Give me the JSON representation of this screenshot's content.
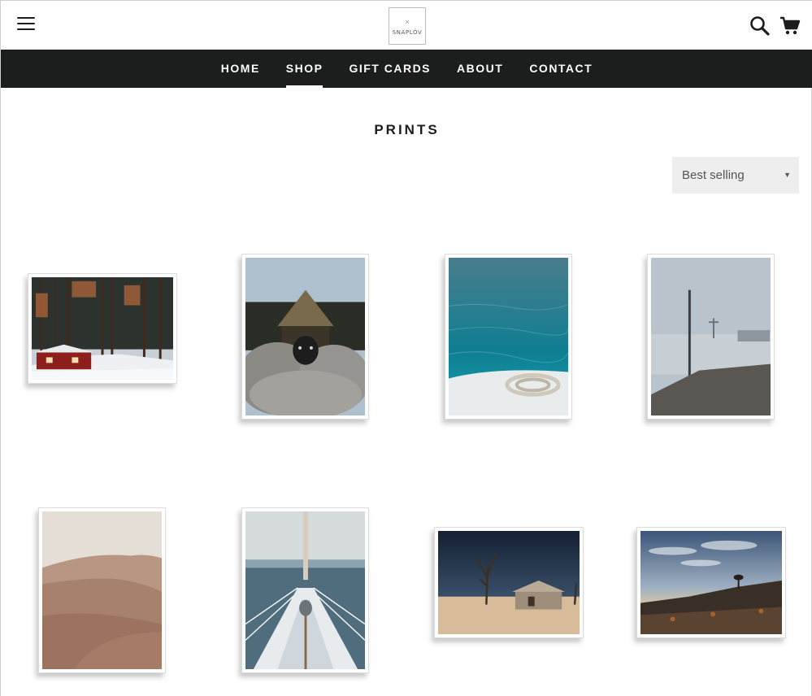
{
  "header": {
    "logo_mark": "×",
    "logo_text": "SNAPLÖV",
    "menu_icon": "hamburger-menu-icon",
    "search_icon": "search-icon",
    "cart_icon": "cart-icon"
  },
  "nav": {
    "items": [
      {
        "label": "HOME",
        "active": false
      },
      {
        "label": "SHOP",
        "active": true
      },
      {
        "label": "GIFT CARDS",
        "active": false
      },
      {
        "label": "ABOUT",
        "active": false
      },
      {
        "label": "CONTACT",
        "active": false
      }
    ]
  },
  "collection": {
    "title": "PRINTS",
    "sort": {
      "selected": "Best selling"
    }
  },
  "colors": {
    "nav_background": "#1c1d1d",
    "nav_text": "#ffffff",
    "sort_background": "#eeeeee"
  },
  "products": [
    {
      "subject": "red cabin in snowy forest"
    },
    {
      "subject": "sheep by thatched hut"
    },
    {
      "subject": "rope on boat over turquoise sea"
    },
    {
      "subject": "misty pier with pole"
    },
    {
      "subject": "desert sand dunes"
    },
    {
      "subject": "sailboat bow at sea"
    },
    {
      "subject": "abandoned house with dead tree in desert"
    },
    {
      "subject": "desert sunset with quiver tree"
    }
  ]
}
